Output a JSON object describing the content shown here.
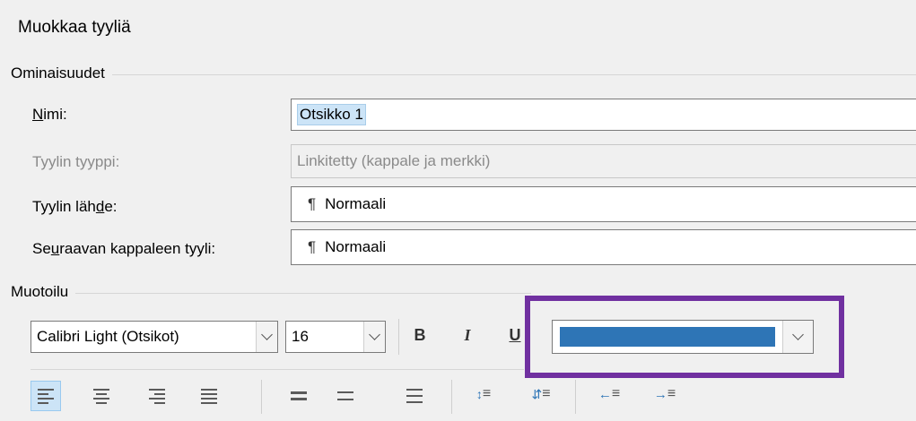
{
  "dialog": {
    "title": "Muokkaa tyyliä"
  },
  "properties": {
    "group_label": "Ominaisuudet",
    "name": {
      "label_pre": "",
      "label_key": "N",
      "label_post": "imi:",
      "value": "Otsikko 1"
    },
    "style_type": {
      "label": "Tyylin tyyppi:",
      "value": "Linkitetty (kappale ja merkki)"
    },
    "style_based_on": {
      "label_pre": "Tyylin läh",
      "label_key": "d",
      "label_post": "e:",
      "value": "Normaali",
      "icon": "pilcrow-icon"
    },
    "next_style": {
      "label_pre": "Se",
      "label_key": "u",
      "label_post": "raavan kappaleen tyyli:",
      "value": "Normaali",
      "icon": "pilcrow-icon"
    }
  },
  "formatting": {
    "group_label": "Muotoilu",
    "font": "Calibri Light (Otsikot)",
    "size": "16",
    "bold": "B",
    "italic": "I",
    "underline": "U",
    "font_color": "#2e75b6",
    "highlight_color": "#7030a0"
  },
  "toolbar_icons": [
    "align-left-icon",
    "align-center-icon",
    "align-right-icon",
    "justify-icon",
    "single-spacing-icon",
    "one-half-spacing-icon",
    "double-spacing-icon",
    "increase-paragraph-spacing-icon",
    "decrease-paragraph-spacing-icon",
    "decrease-indent-icon",
    "increase-indent-icon"
  ]
}
